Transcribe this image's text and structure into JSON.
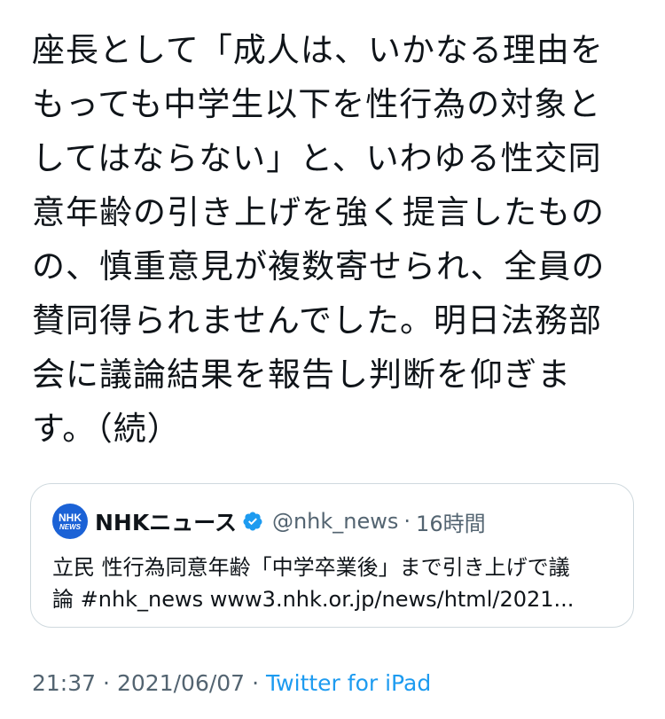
{
  "tweet": {
    "lines": [
      "座長として「成人は、いかなる理由を",
      "もっても中学生以下を性行為の対象と",
      "してはならない」と、いわゆる性交同",
      "意年齢の引き上げを強く提言したもの",
      "の、慎重意見が複数寄せられ、全員の",
      "賛同得られませんでした。明日法務部",
      "会に議論結果を報告し判断を仰ぎま",
      "す。（続）"
    ]
  },
  "quoted_tweet": {
    "avatar_text_top": "NHK",
    "avatar_text_bottom": "NEWS",
    "name": "NHKニュース",
    "verified_icon": "verified-badge-icon",
    "handle": "@nhk_news",
    "dot": "·",
    "time": "16時間",
    "text_lines": [
      "立民 性行為同意年齢「中学卒業後」まで引き上げで議",
      "論 #nhk_news www3.nhk.or.jp/news/html/2021..."
    ]
  },
  "meta": {
    "time": "21:37",
    "sep1": "·",
    "date": "2021/06/07",
    "sep2": "·",
    "source": "Twitter for iPad"
  },
  "colors": {
    "text": "#0f1419",
    "secondary": "#536471",
    "link": "#1d9bf0",
    "verified": "#1d9bf0",
    "border": "#cfd9de",
    "nhk_blue": "#1b62d6"
  }
}
